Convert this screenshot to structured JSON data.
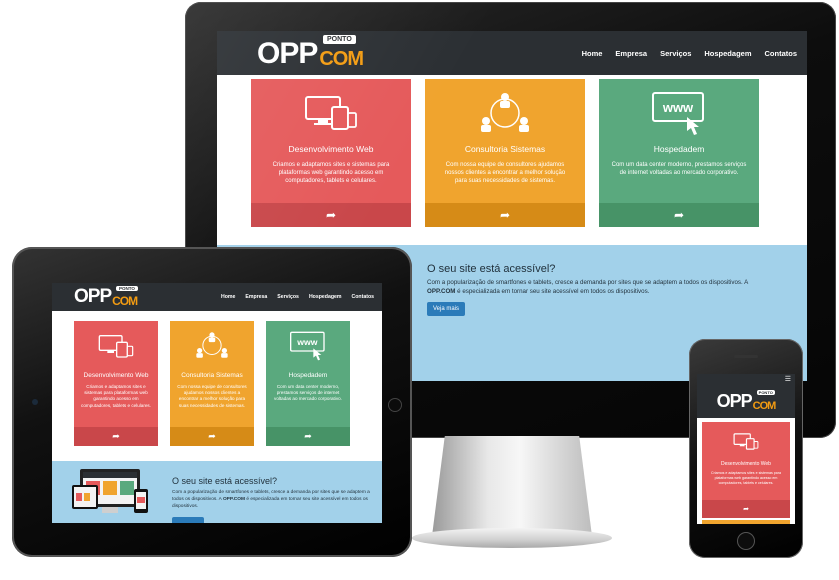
{
  "site": {
    "logo_main": "OPP",
    "logo_com": "COM",
    "logo_ponto": "PONTO",
    "menu": [
      "Home",
      "Empresa",
      "Serviços",
      "Hospedagem",
      "Contatos"
    ],
    "cards": [
      {
        "title": "Desenvolvimento Web",
        "desc": "Criamos e adaptamos sites e sistemas para plataformas web garantindo acesso em computadores, tablets e celulares.",
        "icon": "devices-icon"
      },
      {
        "title": "Consultoria Sistemas",
        "desc": "Com nossa equipe de consultores ajudamos nossos clientes a encontrar a melhor solução para suas necessidades de sistemas.",
        "icon": "people-network-icon"
      },
      {
        "title": "Hospedadem",
        "desc": "Com um data center moderno, prestamos serviços de internet voltadas ao mercado corporativo.",
        "icon": "www-click-icon"
      }
    ],
    "band": {
      "heading": "O seu site está acessível?",
      "text_before": "Com a popularização de smartfones e tablets, cresce a demanda por sites que se adaptem a todos os dispositivos. A ",
      "text_brand": "OPP.COM",
      "text_after": " é especializada em tornar seu site acessível em todos os dispositivos.",
      "button": "Veja mais"
    }
  },
  "colors": {
    "nav": "#2b2f33",
    "red": "#e55a5b",
    "orange": "#f0a42e",
    "green": "#5aa97e",
    "band": "#a2d1ea",
    "button": "#2b7bb9"
  }
}
